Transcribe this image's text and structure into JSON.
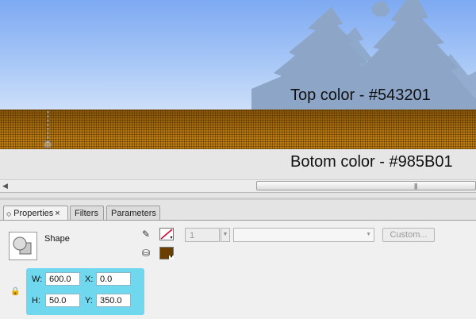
{
  "stage": {
    "top_label": "Top color - #543201",
    "bottom_label": "Botom color - #985B01",
    "top_color": "#543201",
    "bottom_color": "#985B01",
    "sky_color": "#9fc1f5",
    "tree_color": "#8da6c8"
  },
  "scrollbar": {
    "left_arrow_icon": "arrow-left-icon",
    "grip_icon": "grip-lines-icon"
  },
  "panel": {
    "tabs": [
      {
        "label": "Properties",
        "active": true
      },
      {
        "label": "Filters",
        "active": false
      },
      {
        "label": "Parameters",
        "active": false
      }
    ],
    "close_glyph": "×",
    "shape_label": "Shape",
    "stroke": {
      "icon": "pencil-icon",
      "swatch": "no-color",
      "size": "1",
      "custom_label": "Custom..."
    },
    "fill": {
      "icon": "paint-bucket-icon",
      "color": "#6b3f00"
    },
    "geometry": {
      "highlight_color": "#6fd8ee",
      "w_label": "W:",
      "w": "600.0",
      "x_label": "X:",
      "x": "0.0",
      "h_label": "H:",
      "h": "50.0",
      "y_label": "Y:",
      "y": "350.0"
    }
  }
}
